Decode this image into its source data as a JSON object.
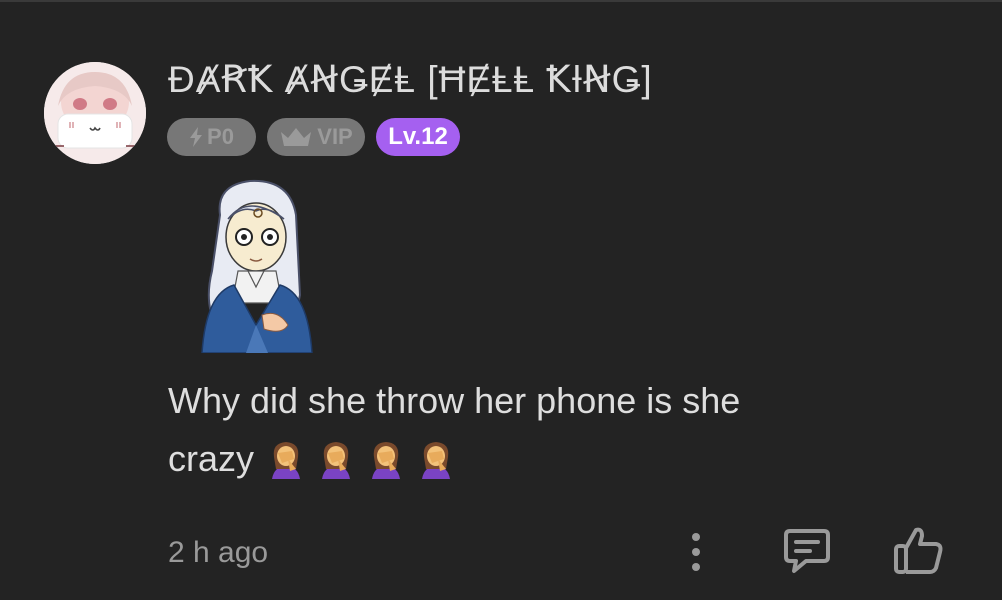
{
  "comment": {
    "username": "ĐȺꞦꝀ ȺꞤǤɆⱠ [ĦɆⱠⱠ ꝀƗꞤǤ]",
    "badges": {
      "points": "P0",
      "vip": "VIP",
      "level": "Lv.12"
    },
    "text": "Why did she throw her phone is she crazy",
    "emojis": [
      "🤦‍♀️",
      "🤦‍♀️",
      "🤦‍♀️",
      "🤦‍♀️"
    ],
    "timestamp": "2 h ago"
  },
  "icons": {
    "more": "more-vertical-icon",
    "reply": "comment-icon",
    "like": "thumbs-up-icon"
  },
  "colors": {
    "background": "#232323",
    "level_badge": "#a560f0",
    "disabled_badge": "#777777",
    "text": "#dedede",
    "muted": "#9a9a9a"
  }
}
